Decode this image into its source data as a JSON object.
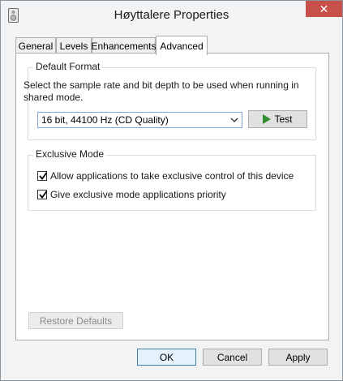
{
  "window": {
    "title": "Høyttalere Properties",
    "close_symbol": "✕",
    "icon": "speaker-properties-icon"
  },
  "tabs": [
    {
      "label": "General",
      "active": false
    },
    {
      "label": "Levels",
      "active": false
    },
    {
      "label": "Enhancements",
      "active": false
    },
    {
      "label": "Advanced",
      "active": true
    }
  ],
  "default_format": {
    "group_label": "Default Format",
    "description": "Select the sample rate and bit depth to be used when running in shared mode.",
    "selected_format": "16 bit, 44100 Hz (CD Quality)",
    "test_label": "Test",
    "test_icon": "play-icon"
  },
  "exclusive_mode": {
    "group_label": "Exclusive Mode",
    "options": [
      {
        "label": "Allow applications to take exclusive control of this device",
        "checked": true
      },
      {
        "label": "Give exclusive mode applications priority",
        "checked": true
      }
    ]
  },
  "restore_defaults_label": "Restore Defaults",
  "footer": {
    "ok_label": "OK",
    "cancel_label": "Cancel",
    "apply_label": "Apply"
  },
  "colors": {
    "close_button": "#c8504b",
    "test_play": "#2f8f2f",
    "select_border": "#7aa7d8",
    "default_button_border": "#3c7fb1"
  }
}
